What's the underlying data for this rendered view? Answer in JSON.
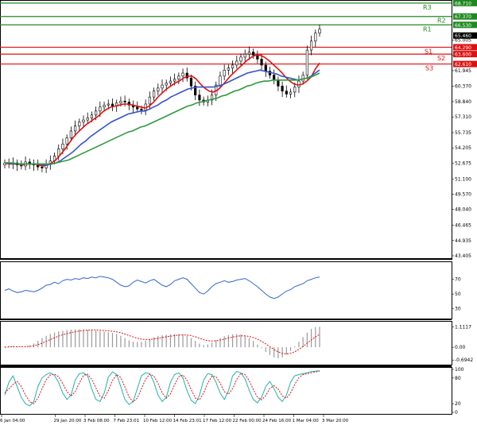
{
  "chart_data": {
    "type": "line",
    "price_panel": {
      "ylim": [
        43.405,
        68.7
      ],
      "y_ticks": [
        "65.005",
        "63.465",
        "61.945",
        "60.370",
        "58.840",
        "57.310",
        "55.735",
        "54.205",
        "52.675",
        "51.100",
        "49.570",
        "48.040",
        "46.465",
        "44.935",
        "43.405"
      ],
      "levels": [
        {
          "name": "R3",
          "value": 68.71,
          "label": "68.710",
          "color": "#1f8a1f",
          "side": "resistance"
        },
        {
          "name": "R2",
          "value": 67.37,
          "label": "67.370",
          "color": "#1f8a1f",
          "side": "resistance"
        },
        {
          "name": "R1",
          "value": 66.53,
          "label": "66.530",
          "color": "#1f8a1f",
          "side": "resistance"
        },
        {
          "name": "S1",
          "value": 64.29,
          "label": "64.290",
          "color": "#e01010",
          "side": "support"
        },
        {
          "name": "S2",
          "value": 63.6,
          "label": "63.600",
          "color": "#e01010",
          "side": "support"
        },
        {
          "name": "S3",
          "value": 62.61,
          "label": "62.610",
          "color": "#e01010",
          "side": "support"
        }
      ],
      "current_price": {
        "label": "65.460",
        "value": 65.46
      },
      "candles_close": [
        52.7,
        52.6,
        52.7,
        52.5,
        52.4,
        52.8,
        52.6,
        52.5,
        52.3,
        52.2,
        52.6,
        52.9,
        53.4,
        54.1,
        54.6,
        55.2,
        55.9,
        56.4,
        56.8,
        57.0,
        57.2,
        57.5,
        57.9,
        58.3,
        58.5,
        58.6,
        58.4,
        58.7,
        58.9,
        58.8,
        58.5,
        58.3,
        58.1,
        58.0,
        58.6,
        59.3,
        59.9,
        60.2,
        60.5,
        60.7,
        60.9,
        61.1,
        61.4,
        61.7,
        61.2,
        60.4,
        59.5,
        59.0,
        58.8,
        59.0,
        59.5,
        60.5,
        61.4,
        62.0,
        62.2,
        62.5,
        62.9,
        63.3,
        63.6,
        63.8,
        63.5,
        63.1,
        62.5,
        61.9,
        61.5,
        61.0,
        60.4,
        59.9,
        59.6,
        59.8,
        60.3,
        60.9,
        61.5,
        64.0,
        64.9,
        65.7,
        66.1
      ],
      "ma_series": [
        {
          "name": "",
          "color": "#e01010",
          "values": [
            52.7,
            52.6,
            52.6,
            52.6,
            52.5,
            52.6,
            52.6,
            52.6,
            52.5,
            52.4,
            52.5,
            52.7,
            53.0,
            53.5,
            54.0,
            54.6,
            55.2,
            55.7,
            56.1,
            56.5,
            56.8,
            57.1,
            57.4,
            57.8,
            58.1,
            58.3,
            58.4,
            58.5,
            58.6,
            58.6,
            58.5,
            58.4,
            58.3,
            58.2,
            58.4,
            58.8,
            59.3,
            59.7,
            60.1,
            60.4,
            60.7,
            60.9,
            61.2,
            61.4,
            61.4,
            61.1,
            60.6,
            60.2,
            59.9,
            59.8,
            60.0,
            60.4,
            60.9,
            61.4,
            61.8,
            62.2,
            62.6,
            63.0,
            63.3,
            63.5,
            63.5,
            63.3,
            63.0,
            62.6,
            62.2,
            61.8,
            61.3,
            60.9,
            60.6,
            60.5,
            60.6,
            60.9,
            61.3,
            62.1,
            62.7
          ]
        },
        {
          "name": "",
          "color": "#3355cc",
          "values": [
            52.7,
            52.7,
            52.6,
            52.6,
            52.6,
            52.6,
            52.6,
            52.6,
            52.6,
            52.5,
            52.5,
            52.6,
            52.7,
            52.9,
            53.2,
            53.5,
            53.8,
            54.2,
            54.6,
            54.9,
            55.3,
            55.6,
            55.9,
            56.2,
            56.5,
            56.8,
            57.0,
            57.2,
            57.4,
            57.6,
            57.7,
            57.8,
            57.9,
            57.9,
            58.1,
            58.3,
            58.5,
            58.8,
            59.0,
            59.3,
            59.5,
            59.7,
            59.9,
            60.1,
            60.2,
            60.3,
            60.3,
            60.3,
            60.3,
            60.3,
            60.4,
            60.5,
            60.7,
            60.9,
            61.1,
            61.3,
            61.5,
            61.7,
            61.8,
            61.9,
            62.0,
            61.9,
            61.8,
            61.7,
            61.6,
            61.4,
            61.3,
            61.2,
            61.1,
            61.0,
            61.1,
            61.2,
            61.4,
            61.7,
            62.0
          ]
        },
        {
          "name": "",
          "color": "#2e9b3a",
          "values": [
            52.7,
            52.7,
            52.7,
            52.6,
            52.6,
            52.6,
            52.6,
            52.6,
            52.6,
            52.6,
            52.6,
            52.6,
            52.7,
            52.8,
            52.9,
            53.0,
            53.2,
            53.4,
            53.6,
            53.8,
            54.0,
            54.2,
            54.4,
            54.6,
            54.8,
            55.0,
            55.2,
            55.4,
            55.6,
            55.8,
            55.9,
            56.1,
            56.3,
            56.4,
            56.6,
            56.8,
            57.0,
            57.2,
            57.4,
            57.6,
            57.8,
            58.0,
            58.2,
            58.4,
            58.5,
            58.7,
            58.8,
            58.9,
            59.0,
            59.1,
            59.2,
            59.4,
            59.5,
            59.7,
            59.9,
            60.0,
            60.2,
            60.4,
            60.5,
            60.7,
            60.8,
            60.9,
            60.9,
            61.0,
            61.0,
            61.0,
            61.0,
            61.0,
            61.0,
            61.0,
            61.1,
            61.2,
            61.3,
            61.5,
            61.7
          ]
        }
      ]
    },
    "rsi_panel": {
      "ylim": [
        20,
        90
      ],
      "y_ticks": [
        "70",
        "50",
        "30"
      ],
      "color": "#3366cc",
      "values": [
        55,
        57,
        54,
        52,
        53,
        55,
        54,
        53,
        55,
        58,
        62,
        63,
        66,
        64,
        68,
        70,
        69,
        71,
        70,
        72,
        71,
        73,
        72,
        74,
        73,
        72,
        70,
        66,
        62,
        60,
        61,
        66,
        69,
        67,
        65,
        68,
        70,
        66,
        62,
        60,
        63,
        68,
        70,
        72,
        70,
        64,
        58,
        52,
        50,
        54,
        60,
        64,
        66,
        68,
        66,
        67,
        69,
        70,
        71,
        68,
        64,
        60,
        55,
        50,
        46,
        44,
        46,
        50,
        54,
        56,
        60,
        62,
        64,
        68,
        70,
        72,
        73
      ]
    },
    "macd_panel": {
      "ylim": [
        -0.9,
        1.3
      ],
      "y_ticks": [
        "1.1117",
        "0.00",
        "-0.6942"
      ],
      "hist_color": "#9a9a9a",
      "signal_color": "#e01010",
      "hist": [
        0.05,
        0.08,
        0.06,
        0.04,
        0.02,
        0.05,
        0.1,
        0.2,
        0.35,
        0.5,
        0.62,
        0.72,
        0.8,
        0.86,
        0.9,
        0.94,
        0.96,
        0.97,
        0.98,
        0.97,
        0.95,
        0.93,
        0.9,
        0.88,
        0.85,
        0.82,
        0.78,
        0.72,
        0.62,
        0.5,
        0.38,
        0.3,
        0.28,
        0.3,
        0.35,
        0.45,
        0.55,
        0.62,
        0.66,
        0.68,
        0.7,
        0.72,
        0.72,
        0.7,
        0.62,
        0.5,
        0.35,
        0.2,
        0.12,
        0.15,
        0.25,
        0.38,
        0.5,
        0.6,
        0.66,
        0.7,
        0.72,
        0.7,
        0.62,
        0.5,
        0.35,
        0.15,
        -0.05,
        -0.25,
        -0.42,
        -0.55,
        -0.6,
        -0.55,
        -0.4,
        -0.2,
        0.05,
        0.3,
        0.55,
        0.8,
        1.0,
        1.1,
        1.11
      ],
      "signal": [
        0.0,
        0.02,
        0.03,
        0.03,
        0.03,
        0.03,
        0.05,
        0.08,
        0.14,
        0.22,
        0.32,
        0.42,
        0.52,
        0.6,
        0.68,
        0.74,
        0.8,
        0.84,
        0.88,
        0.91,
        0.93,
        0.94,
        0.94,
        0.93,
        0.91,
        0.89,
        0.87,
        0.84,
        0.79,
        0.72,
        0.64,
        0.56,
        0.49,
        0.44,
        0.42,
        0.42,
        0.45,
        0.49,
        0.53,
        0.57,
        0.6,
        0.63,
        0.66,
        0.67,
        0.66,
        0.63,
        0.57,
        0.49,
        0.41,
        0.36,
        0.34,
        0.35,
        0.39,
        0.44,
        0.5,
        0.55,
        0.6,
        0.62,
        0.62,
        0.59,
        0.53,
        0.44,
        0.32,
        0.18,
        0.03,
        -0.12,
        -0.25,
        -0.33,
        -0.36,
        -0.33,
        -0.25,
        -0.12,
        0.04,
        0.22,
        0.4,
        0.56,
        0.7
      ]
    },
    "stoch_panel": {
      "ylim": [
        0,
        100
      ],
      "y_ticks": [
        "100",
        "80",
        "20",
        "0"
      ],
      "k_color": "#20b2aa",
      "d_color": "#e01010",
      "k": [
        40,
        70,
        85,
        60,
        35,
        20,
        15,
        25,
        60,
        80,
        88,
        92,
        86,
        70,
        45,
        30,
        40,
        75,
        90,
        92,
        85,
        55,
        30,
        25,
        45,
        82,
        94,
        88,
        60,
        30,
        18,
        25,
        55,
        85,
        92,
        90,
        70,
        40,
        25,
        35,
        70,
        88,
        92,
        80,
        50,
        28,
        20,
        40,
        75,
        90,
        88,
        70,
        45,
        30,
        50,
        85,
        95,
        92,
        78,
        52,
        30,
        22,
        35,
        60,
        72,
        55,
        35,
        25,
        40,
        70,
        85,
        88,
        90,
        92,
        95,
        96,
        97
      ],
      "d": [
        45,
        55,
        65,
        72,
        60,
        40,
        25,
        20,
        33,
        55,
        76,
        87,
        89,
        83,
        67,
        48,
        38,
        48,
        68,
        86,
        89,
        77,
        57,
        37,
        33,
        51,
        74,
        88,
        81,
        59,
        36,
        24,
        33,
        55,
        77,
        89,
        84,
        67,
        45,
        33,
        43,
        64,
        83,
        87,
        74,
        53,
        33,
        29,
        45,
        68,
        84,
        83,
        68,
        48,
        42,
        55,
        77,
        91,
        88,
        74,
        53,
        35,
        29,
        39,
        56,
        62,
        54,
        38,
        33,
        45,
        65,
        81,
        88,
        90,
        92,
        94,
        96
      ]
    },
    "x_labels": [
      "6 Jan 04:00",
      "29 Jan 20:00",
      "3 Feb 08:00",
      "7 Feb 23:01",
      "10 Feb 12:00",
      "14 Feb 23:01",
      "17 Feb 12:00",
      "22 Feb 00:00",
      "24 Feb 16:00",
      "1 Mar 04:00",
      "3 Mar 20:00"
    ]
  }
}
